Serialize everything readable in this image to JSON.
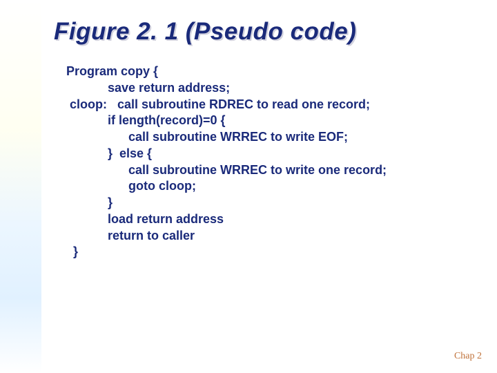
{
  "title": "Figure 2. 1 (Pseudo code)",
  "code": {
    "l1": "Program copy {",
    "l2": "            save return address;",
    "l3": " cloop:   call subroutine RDREC to read one record;",
    "l4": "            if length(record)=0 {",
    "l5": "                  call subroutine WRREC to write EOF;",
    "l6": "            }  else {",
    "l7": "                  call subroutine WRREC to write one record;",
    "l8": "                  goto cloop;",
    "l9": "            }",
    "l10": "            load return address",
    "l11": "            return to caller",
    "l12": "  }"
  },
  "footer": "Chap 2"
}
